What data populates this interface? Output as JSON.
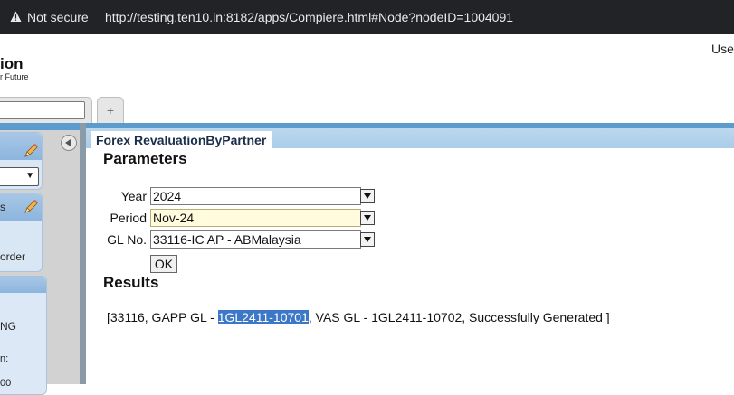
{
  "browser": {
    "security_label": "Not secure",
    "url": "http://testing.ten10.in:8182/apps/Compiere.html#Node?nodeID=1004091"
  },
  "app": {
    "title_fragment": "ion",
    "subtitle_fragment": "r Future",
    "user_fragment": "Use"
  },
  "tabs": {
    "add_label": "+"
  },
  "sidebar": {
    "panel2_fragment": "s",
    "panel2_text": "order",
    "panel3_lines": [
      "NG",
      "n:",
      "00"
    ]
  },
  "window": {
    "tab_title": "Forex RevaluationByPartner",
    "parameters_heading": "Parameters",
    "results_heading": "Results",
    "params": [
      {
        "label": "Year",
        "value": "2024"
      },
      {
        "label": "Period",
        "value": "Nov-24"
      },
      {
        "label": "GL No.",
        "value": "33116-IC AP - ABMalaysia"
      }
    ],
    "ok_label": "OK",
    "result": {
      "before": "[33116, GAPP GL - ",
      "selected": "1GL2411-10701",
      "after": ", VAS GL - 1GL2411-10702, Successfully Generated ]"
    }
  },
  "colors": {
    "accent": "#5b9ccd",
    "panel_bg": "#d9e7f5",
    "highlight_field": "#fffbdc",
    "selection": "#3d77c7"
  }
}
